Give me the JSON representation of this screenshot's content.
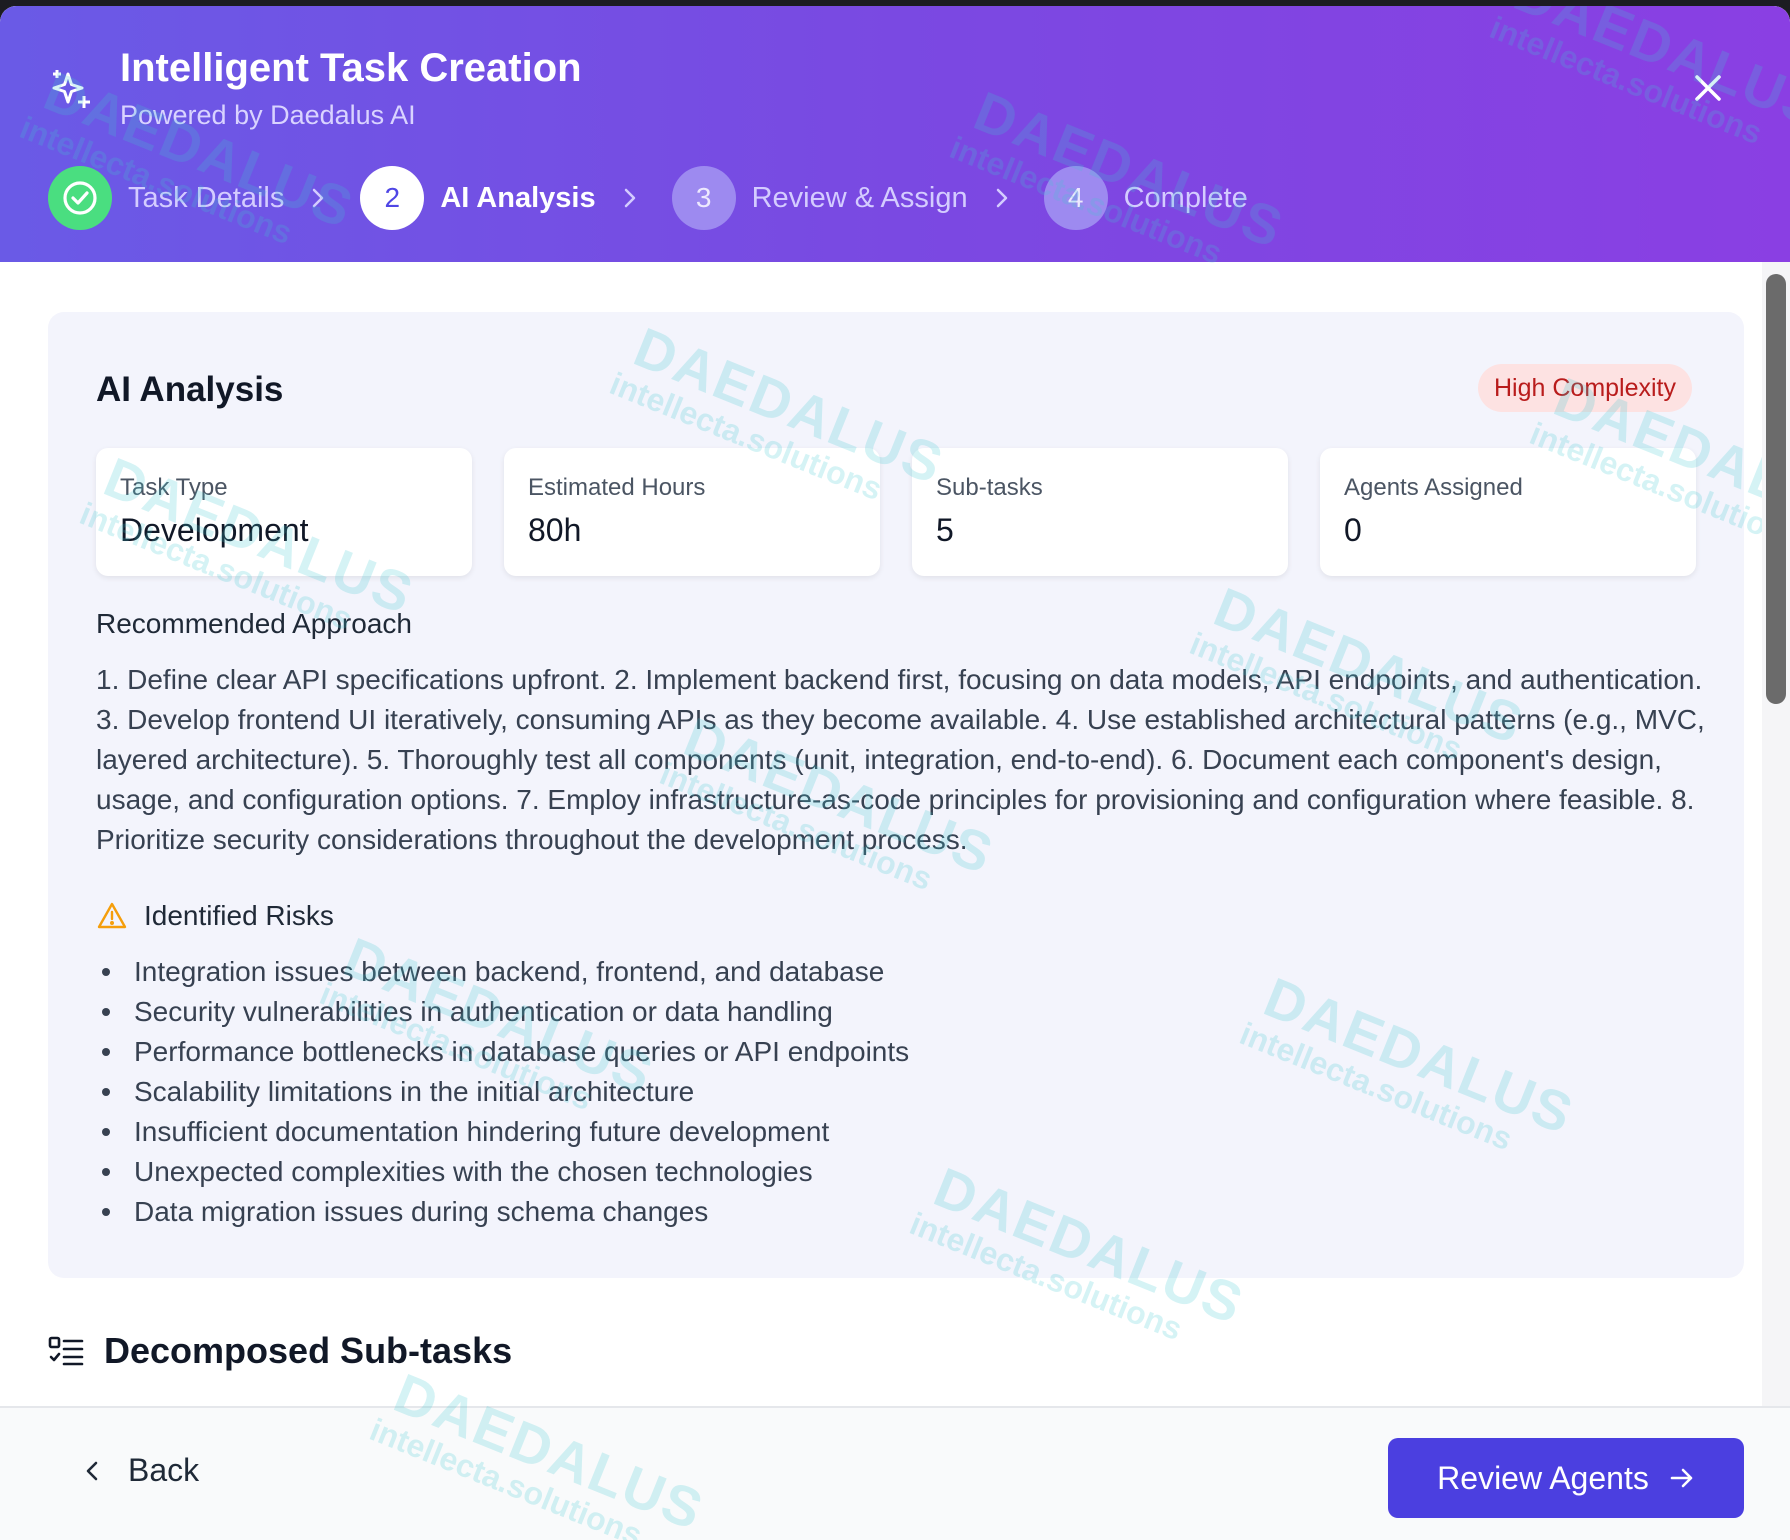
{
  "header": {
    "title": "Intelligent Task Creation",
    "subtitle": "Powered by Daedalus AI"
  },
  "steps": [
    {
      "number": "1",
      "label": "Task Details",
      "state": "done"
    },
    {
      "number": "2",
      "label": "AI Analysis",
      "state": "active"
    },
    {
      "number": "3",
      "label": "Review & Assign",
      "state": "pending"
    },
    {
      "number": "4",
      "label": "Complete",
      "state": "pending"
    }
  ],
  "analysis": {
    "title": "AI Analysis",
    "complexity_badge": "High Complexity",
    "stats": [
      {
        "label": "Task Type",
        "value": "Development"
      },
      {
        "label": "Estimated Hours",
        "value": "80h"
      },
      {
        "label": "Sub-tasks",
        "value": "5"
      },
      {
        "label": "Agents Assigned",
        "value": "0"
      }
    ],
    "approach_heading": "Recommended Approach",
    "approach_text": "1. Define clear API specifications upfront. 2. Implement backend first, focusing on data models, API endpoints, and authentication. 3. Develop frontend UI iteratively, consuming APIs as they become available. 4. Use established architectural patterns (e.g., MVC, layered architecture). 5. Thoroughly test all components (unit, integration, end-to-end). 6. Document each component's design, usage, and configuration options. 7. Employ infrastructure-as-code principles for provisioning and configuration where feasible. 8. Prioritize security considerations throughout the development process.",
    "risks_heading": "Identified Risks",
    "risks": [
      "Integration issues between backend, frontend, and database",
      "Security vulnerabilities in authentication or data handling",
      "Performance bottlenecks in database queries or API endpoints",
      "Scalability limitations in the initial architecture",
      "Insufficient documentation hindering future development",
      "Unexpected complexities with the chosen technologies",
      "Data migration issues during schema changes"
    ]
  },
  "subtasks": {
    "heading": "Decomposed Sub-tasks"
  },
  "footer": {
    "back_label": "Back",
    "primary_label": "Review Agents"
  },
  "watermark": {
    "line1": "DAEDALUS",
    "line2": "intellecta.solutions"
  },
  "colors": {
    "header_gradient_start": "#6a5ae6",
    "header_gradient_end": "#8a3fe3",
    "step_done": "#4ade80",
    "primary_button": "#4b3fe0",
    "badge_bg": "#fde2e2",
    "badge_text": "#b91c1c",
    "risk_icon": "#f59e0b"
  },
  "icons": {
    "header": "sparkles-icon",
    "close": "close-icon",
    "step_done": "check-circle-icon",
    "step_separator": "chevron-right-icon",
    "risks": "warning-triangle-icon",
    "subtasks": "list-checks-icon",
    "back": "chevron-left-icon",
    "primary": "arrow-right-icon"
  }
}
